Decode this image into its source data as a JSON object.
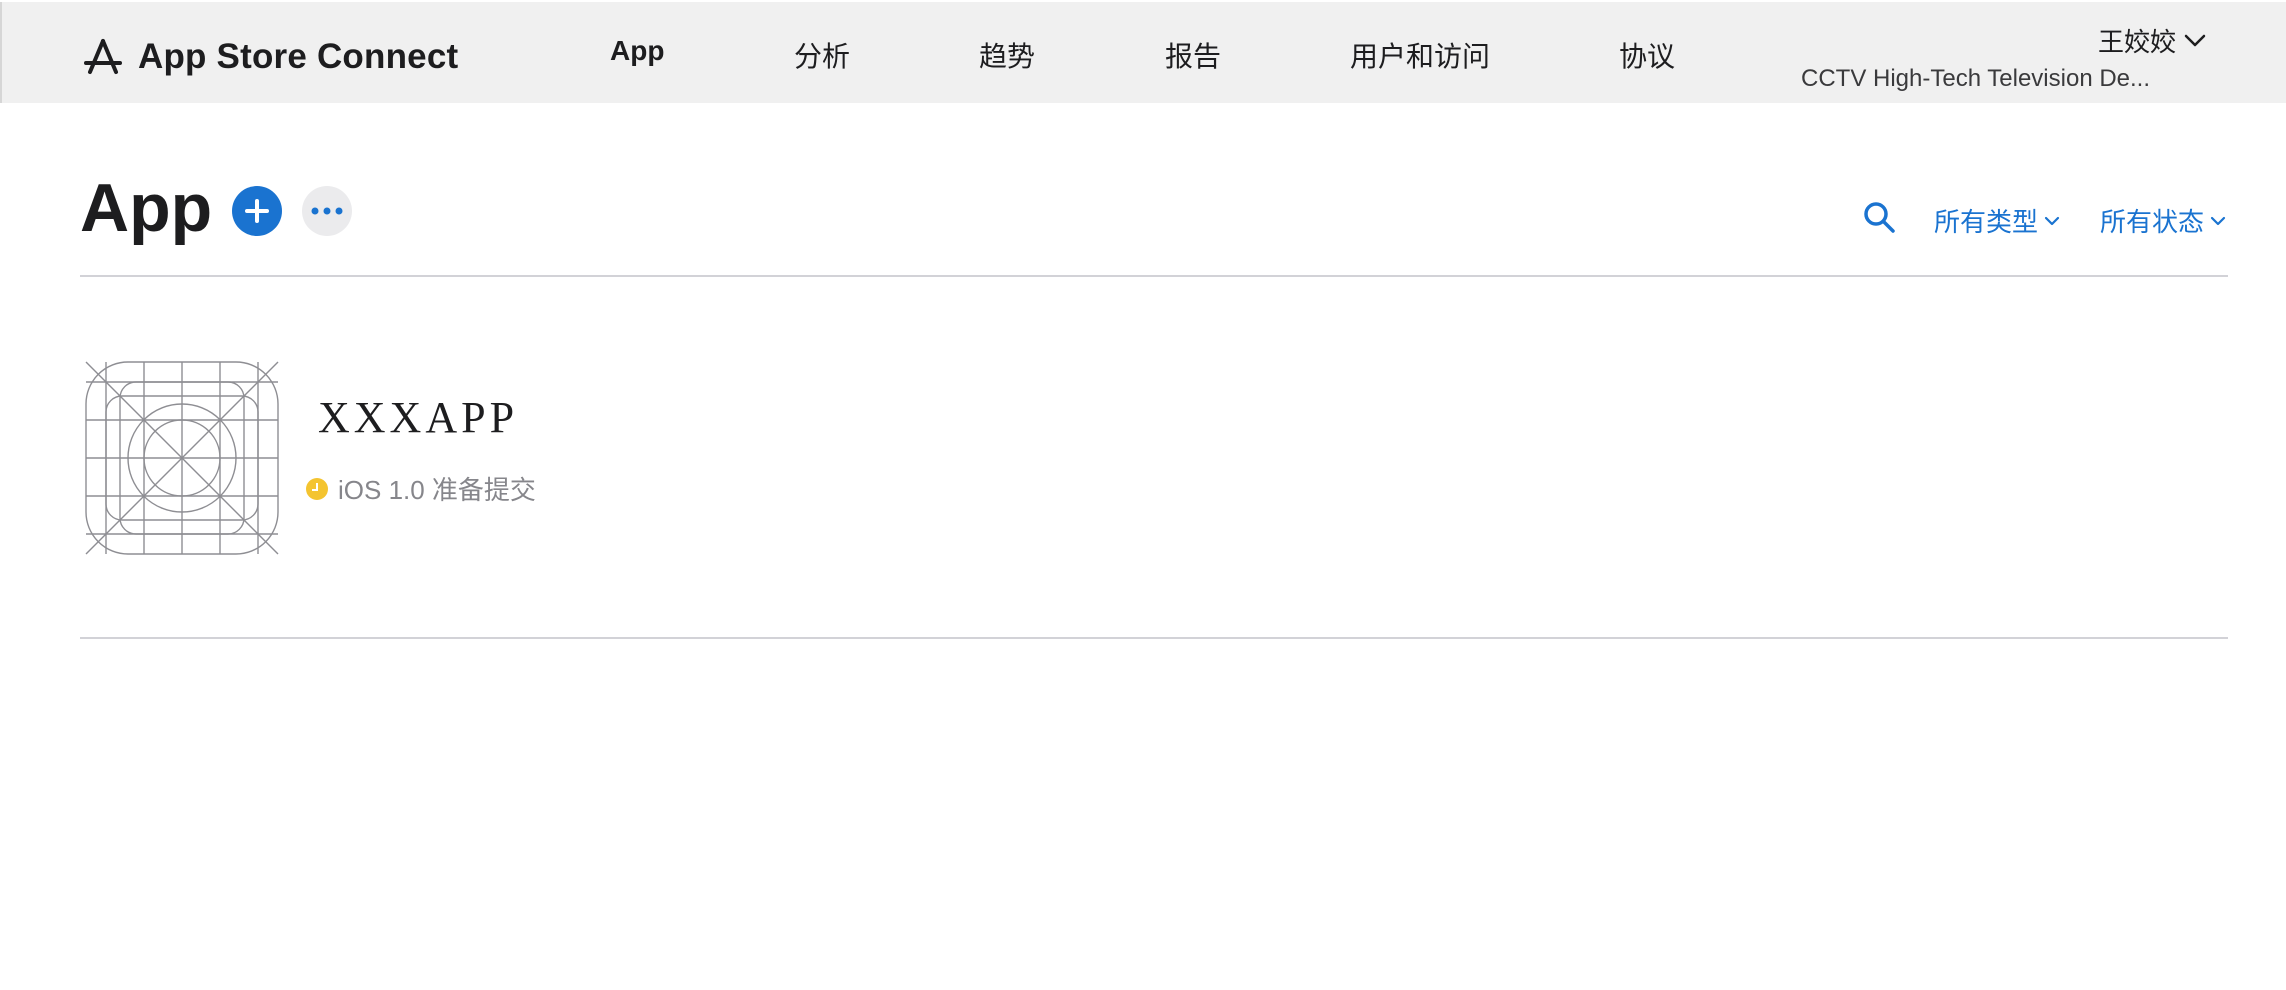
{
  "header": {
    "brand": "App Store Connect",
    "nav": [
      {
        "label": "App",
        "active": true
      },
      {
        "label": "分析",
        "active": false
      },
      {
        "label": "趋势",
        "active": false
      },
      {
        "label": "报告",
        "active": false
      },
      {
        "label": "用户和访问",
        "active": false
      },
      {
        "label": "协议",
        "active": false
      }
    ],
    "account": {
      "name": "王姣姣",
      "organization": "CCTV High-Tech Television De..."
    }
  },
  "page": {
    "title": "App",
    "filters": {
      "type": "所有类型",
      "status": "所有状态"
    },
    "icons": {
      "add": "plus-icon",
      "more": "ellipsis-icon",
      "search": "search-icon"
    }
  },
  "apps": [
    {
      "name": "XXXAPP",
      "platform_status": "iOS 1.0 准备提交",
      "status_color": "#f4c430"
    }
  ],
  "colors": {
    "accent": "#1a73d0",
    "nav_background": "#f0f0f0",
    "status_pending": "#f4c430"
  }
}
